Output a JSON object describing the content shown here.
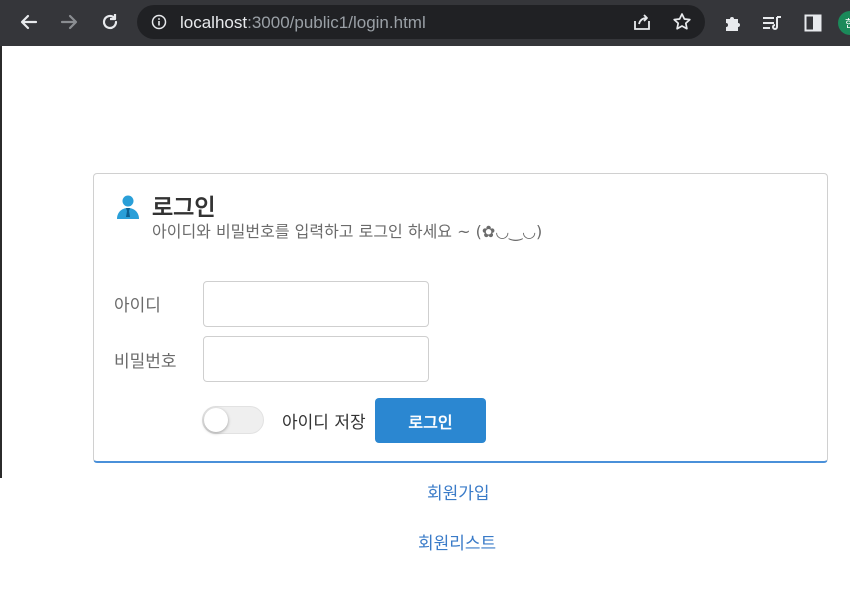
{
  "browser": {
    "url_host": "localhost",
    "url_path": ":3000/public1/login.html",
    "profile_initial": "한"
  },
  "login": {
    "title": "로그인",
    "subtitle": "아이디와 비밀번호를 입력하고 로그인 하세요 ~ (✿◡‿◡)",
    "id_label": "아이디",
    "id_value": "",
    "password_label": "비밀번호",
    "password_value": "",
    "remember_label": "아이디 저장",
    "remember_on": false,
    "submit_label": "로그인"
  },
  "links": {
    "signup": "회원가입",
    "member_list": "회원리스트"
  },
  "colors": {
    "chrome_bg": "#35363a",
    "accent": "#2b87d1",
    "link": "#3a7bc8"
  }
}
